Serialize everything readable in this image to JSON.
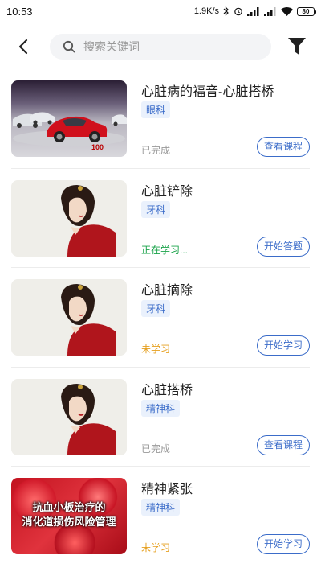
{
  "status_bar": {
    "time": "10:53",
    "network_speed": "1.9K/s",
    "battery": "80"
  },
  "search": {
    "placeholder": "搜索关键词"
  },
  "courses": [
    {
      "title": "心脏病的福音-心脏搭桥",
      "department": "眼科",
      "status": "已完成",
      "status_color": "#999999",
      "action": "查看课程",
      "thumb": "car",
      "thumb_text": "100"
    },
    {
      "title": "心脏铲除",
      "department": "牙科",
      "status": "正在学习...",
      "status_color": "#1aa34a",
      "action": "开始答题",
      "thumb": "lady"
    },
    {
      "title": "心脏摘除",
      "department": "牙科",
      "status": "未学习",
      "status_color": "#e6a020",
      "action": "开始学习",
      "thumb": "lady"
    },
    {
      "title": "心脏搭桥",
      "department": "精神科",
      "status": "已完成",
      "status_color": "#999999",
      "action": "查看课程",
      "thumb": "lady"
    },
    {
      "title": "精神紧张",
      "department": "精神科",
      "status": "未学习",
      "status_color": "#e6a020",
      "action": "开始学习",
      "thumb": "blood",
      "thumb_text_line1": "抗血小板治疗的",
      "thumb_text_line2": "消化道损伤风险管理"
    }
  ],
  "colors": {
    "accent": "#3b6cc9",
    "tag_bg": "#eaf1fc"
  }
}
